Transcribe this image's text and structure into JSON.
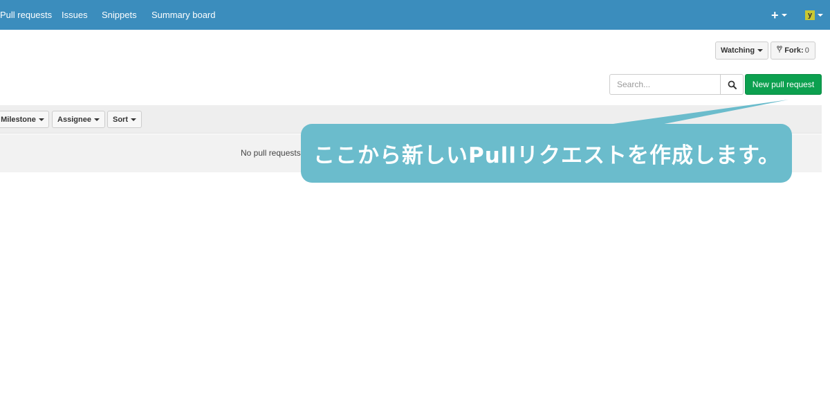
{
  "colors": {
    "nav_bg": "#3b8dbd",
    "primary_green": "#0ca04f",
    "callout_bg": "#6bbccc"
  },
  "nav": {
    "links": [
      "Pull requests",
      "Issues",
      "Snippets",
      "Summary board"
    ],
    "plus_icon": "plus-icon",
    "avatar_letter": "y"
  },
  "repo_actions": {
    "watching_label": "Watching",
    "fork_label": "Fork:",
    "fork_count": "0"
  },
  "search": {
    "placeholder": "Search...",
    "icon": "search-icon"
  },
  "new_pull_request_label": "New pull request",
  "filters": [
    "Milestone",
    "Assignee",
    "Sort"
  ],
  "empty_state": "No pull requests t",
  "callout": {
    "text": "ここから新しいPullリクエストを作成します。"
  }
}
